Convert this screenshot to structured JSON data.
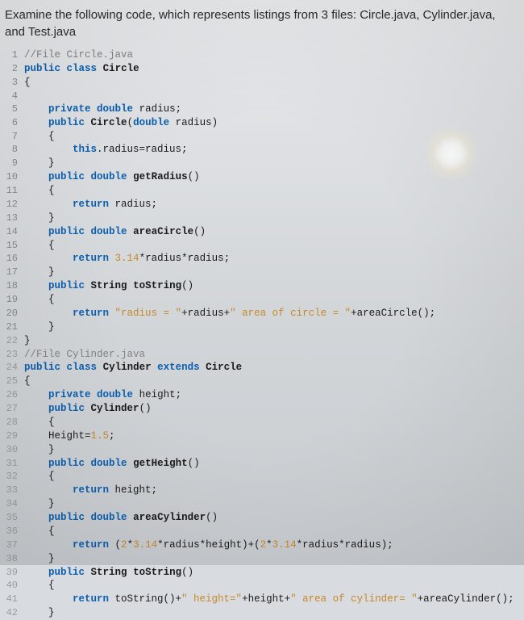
{
  "header": {
    "text": "Examine the following code, which represents listings from 3 files: Circle.java, Cylinder.java, and Test.java"
  },
  "code": {
    "lines": [
      {
        "num": "1",
        "indent": 0,
        "tokens": [
          [
            "comment",
            "//File Circle.java"
          ]
        ]
      },
      {
        "num": "2",
        "indent": 0,
        "tokens": [
          [
            "keyword",
            "public"
          ],
          [
            "plain",
            " "
          ],
          [
            "keyword",
            "class"
          ],
          [
            "plain",
            " "
          ],
          [
            "classname",
            "Circle"
          ]
        ]
      },
      {
        "num": "3",
        "indent": 0,
        "tokens": [
          [
            "punct",
            "{"
          ]
        ]
      },
      {
        "num": "4",
        "indent": 0,
        "tokens": []
      },
      {
        "num": "5",
        "indent": 2,
        "tokens": [
          [
            "keyword",
            "private"
          ],
          [
            "plain",
            " "
          ],
          [
            "type",
            "double"
          ],
          [
            "plain",
            " radius;"
          ]
        ]
      },
      {
        "num": "6",
        "indent": 2,
        "tokens": [
          [
            "keyword",
            "public"
          ],
          [
            "plain",
            " "
          ],
          [
            "classname",
            "Circle"
          ],
          [
            "punct",
            "("
          ],
          [
            "type",
            "double"
          ],
          [
            "plain",
            " radius)"
          ]
        ]
      },
      {
        "num": "7",
        "indent": 2,
        "tokens": [
          [
            "punct",
            "{"
          ]
        ]
      },
      {
        "num": "8",
        "indent": 4,
        "tokens": [
          [
            "keyword",
            "this"
          ],
          [
            "plain",
            ".radius=radius;"
          ]
        ]
      },
      {
        "num": "9",
        "indent": 2,
        "tokens": [
          [
            "punct",
            "}"
          ]
        ]
      },
      {
        "num": "10",
        "indent": 2,
        "tokens": [
          [
            "keyword",
            "public"
          ],
          [
            "plain",
            " "
          ],
          [
            "type",
            "double"
          ],
          [
            "plain",
            " "
          ],
          [
            "method",
            "getRadius"
          ],
          [
            "punct",
            "()"
          ]
        ]
      },
      {
        "num": "11",
        "indent": 2,
        "tokens": [
          [
            "punct",
            "{"
          ]
        ]
      },
      {
        "num": "12",
        "indent": 4,
        "tokens": [
          [
            "keyword",
            "return"
          ],
          [
            "plain",
            " radius;"
          ]
        ]
      },
      {
        "num": "13",
        "indent": 2,
        "tokens": [
          [
            "punct",
            "}"
          ]
        ]
      },
      {
        "num": "14",
        "indent": 2,
        "tokens": [
          [
            "keyword",
            "public"
          ],
          [
            "plain",
            " "
          ],
          [
            "type",
            "double"
          ],
          [
            "plain",
            " "
          ],
          [
            "method",
            "areaCircle"
          ],
          [
            "punct",
            "()"
          ]
        ]
      },
      {
        "num": "15",
        "indent": 2,
        "tokens": [
          [
            "punct",
            "{"
          ]
        ]
      },
      {
        "num": "16",
        "indent": 4,
        "tokens": [
          [
            "keyword",
            "return"
          ],
          [
            "plain",
            " "
          ],
          [
            "number",
            "3.14"
          ],
          [
            "plain",
            "*radius*radius;"
          ]
        ]
      },
      {
        "num": "17",
        "indent": 2,
        "tokens": [
          [
            "punct",
            "}"
          ]
        ]
      },
      {
        "num": "18",
        "indent": 2,
        "tokens": [
          [
            "keyword",
            "public"
          ],
          [
            "plain",
            " "
          ],
          [
            "classname",
            "String"
          ],
          [
            "plain",
            " "
          ],
          [
            "method",
            "toString"
          ],
          [
            "punct",
            "()"
          ]
        ]
      },
      {
        "num": "19",
        "indent": 2,
        "tokens": [
          [
            "punct",
            "{"
          ]
        ]
      },
      {
        "num": "20",
        "indent": 4,
        "tokens": [
          [
            "keyword",
            "return"
          ],
          [
            "plain",
            " "
          ],
          [
            "string",
            "\"radius = \""
          ],
          [
            "plain",
            "+radius+"
          ],
          [
            "string",
            "\" area of circle = \""
          ],
          [
            "plain",
            "+areaCircle();"
          ]
        ]
      },
      {
        "num": "21",
        "indent": 2,
        "tokens": [
          [
            "punct",
            "}"
          ]
        ]
      },
      {
        "num": "22",
        "indent": 0,
        "tokens": [
          [
            "punct",
            "}"
          ]
        ]
      },
      {
        "num": "23",
        "indent": 0,
        "tokens": [
          [
            "comment",
            "//File Cylinder.java"
          ]
        ]
      },
      {
        "num": "24",
        "indent": 0,
        "tokens": [
          [
            "keyword",
            "public"
          ],
          [
            "plain",
            " "
          ],
          [
            "keyword",
            "class"
          ],
          [
            "plain",
            " "
          ],
          [
            "classname",
            "Cylinder"
          ],
          [
            "plain",
            " "
          ],
          [
            "keyword",
            "extends"
          ],
          [
            "plain",
            " "
          ],
          [
            "classname",
            "Circle"
          ]
        ]
      },
      {
        "num": "25",
        "indent": 0,
        "tokens": [
          [
            "punct",
            "{"
          ]
        ]
      },
      {
        "num": "26",
        "indent": 2,
        "tokens": [
          [
            "keyword",
            "private"
          ],
          [
            "plain",
            " "
          ],
          [
            "type",
            "double"
          ],
          [
            "plain",
            " height;"
          ]
        ]
      },
      {
        "num": "27",
        "indent": 2,
        "tokens": [
          [
            "keyword",
            "public"
          ],
          [
            "plain",
            " "
          ],
          [
            "classname",
            "Cylinder"
          ],
          [
            "punct",
            "()"
          ]
        ]
      },
      {
        "num": "28",
        "indent": 2,
        "tokens": [
          [
            "punct",
            "{"
          ]
        ]
      },
      {
        "num": "29",
        "indent": 2,
        "tokens": [
          [
            "plain",
            "Height="
          ],
          [
            "number",
            "1.5"
          ],
          [
            "plain",
            ";"
          ]
        ]
      },
      {
        "num": "30",
        "indent": 2,
        "tokens": [
          [
            "punct",
            "}"
          ]
        ]
      },
      {
        "num": "31",
        "indent": 2,
        "tokens": [
          [
            "keyword",
            "public"
          ],
          [
            "plain",
            " "
          ],
          [
            "type",
            "double"
          ],
          [
            "plain",
            " "
          ],
          [
            "method",
            "getHeight"
          ],
          [
            "punct",
            "()"
          ]
        ]
      },
      {
        "num": "32",
        "indent": 2,
        "tokens": [
          [
            "punct",
            "{"
          ]
        ]
      },
      {
        "num": "33",
        "indent": 4,
        "tokens": [
          [
            "keyword",
            "return"
          ],
          [
            "plain",
            " height;"
          ]
        ]
      },
      {
        "num": "34",
        "indent": 2,
        "tokens": [
          [
            "punct",
            "}"
          ]
        ]
      },
      {
        "num": "35",
        "indent": 2,
        "tokens": [
          [
            "keyword",
            "public"
          ],
          [
            "plain",
            " "
          ],
          [
            "type",
            "double"
          ],
          [
            "plain",
            " "
          ],
          [
            "method",
            "areaCylinder"
          ],
          [
            "punct",
            "()"
          ]
        ]
      },
      {
        "num": "36",
        "indent": 2,
        "tokens": [
          [
            "punct",
            "{"
          ]
        ]
      },
      {
        "num": "37",
        "indent": 4,
        "tokens": [
          [
            "keyword",
            "return"
          ],
          [
            "plain",
            " ("
          ],
          [
            "number",
            "2"
          ],
          [
            "plain",
            "*"
          ],
          [
            "number",
            "3.14"
          ],
          [
            "plain",
            "*radius*height)+("
          ],
          [
            "number",
            "2"
          ],
          [
            "plain",
            "*"
          ],
          [
            "number",
            "3.14"
          ],
          [
            "plain",
            "*radius*radius);"
          ]
        ]
      },
      {
        "num": "38",
        "indent": 2,
        "tokens": [
          [
            "punct",
            "}"
          ]
        ]
      },
      {
        "num": "39",
        "indent": 2,
        "tokens": [
          [
            "keyword",
            "public"
          ],
          [
            "plain",
            " "
          ],
          [
            "classname",
            "String"
          ],
          [
            "plain",
            " "
          ],
          [
            "method",
            "toString"
          ],
          [
            "punct",
            "()"
          ]
        ]
      },
      {
        "num": "40",
        "indent": 2,
        "tokens": [
          [
            "punct",
            "{"
          ]
        ]
      },
      {
        "num": "41",
        "indent": 4,
        "tokens": [
          [
            "keyword",
            "return"
          ],
          [
            "plain",
            " toString()+"
          ],
          [
            "string",
            "\" height=\""
          ],
          [
            "plain",
            "+height+"
          ],
          [
            "string",
            "\" area of cylinder= \""
          ],
          [
            "plain",
            "+areaCylinder();"
          ]
        ]
      },
      {
        "num": "42",
        "indent": 2,
        "tokens": [
          [
            "punct",
            "}"
          ]
        ]
      }
    ]
  }
}
